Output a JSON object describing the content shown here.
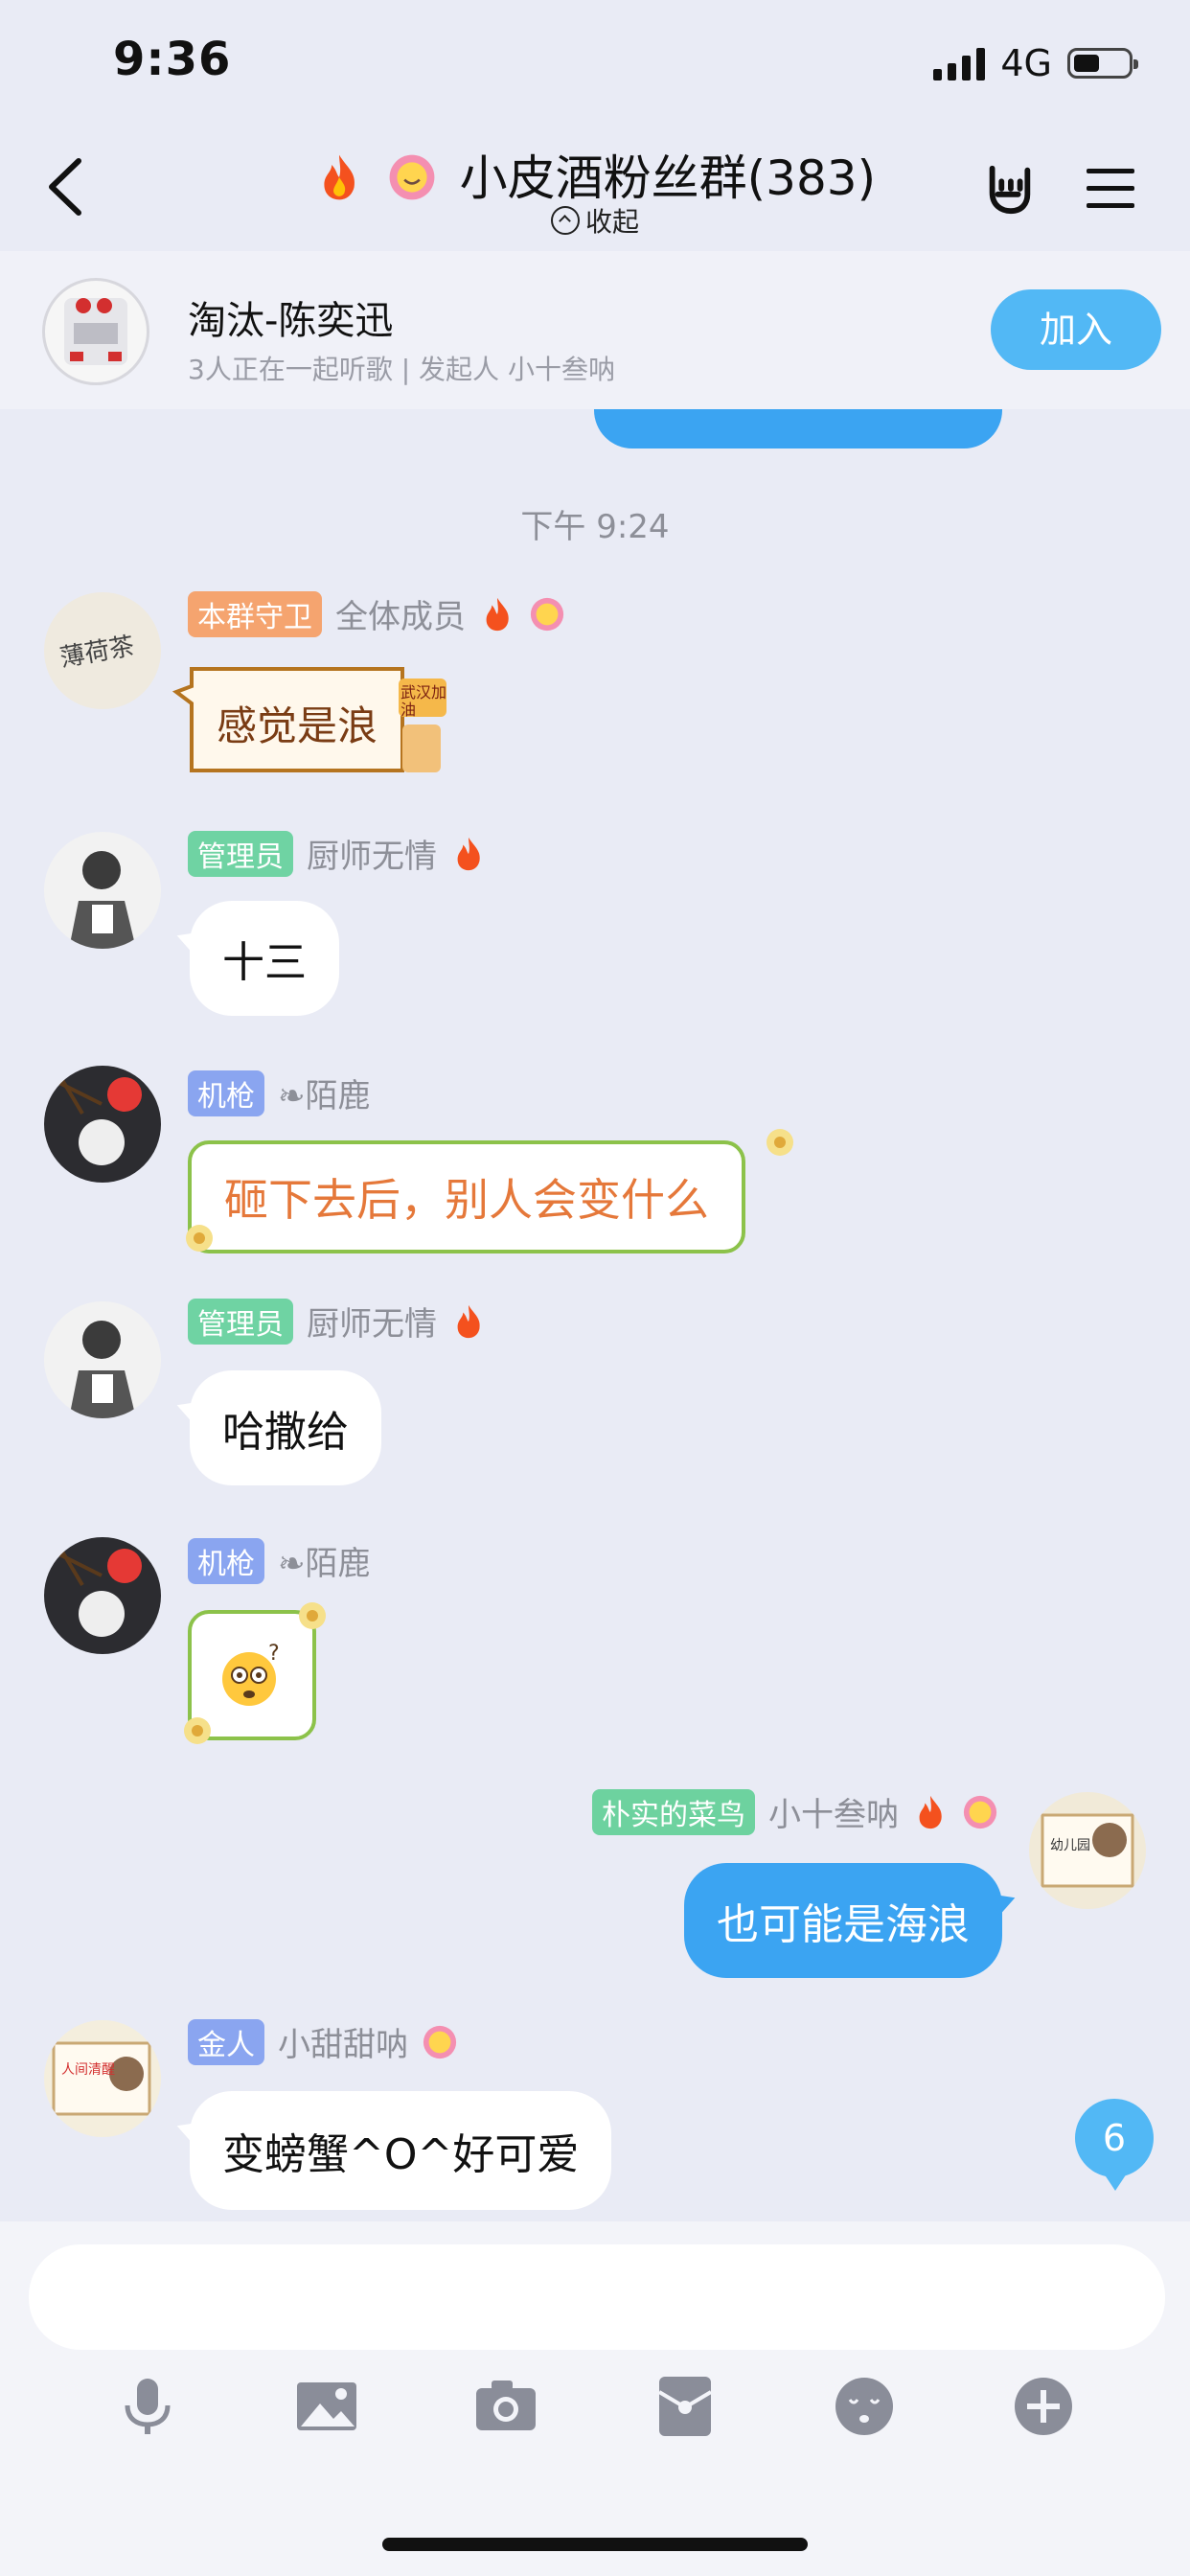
{
  "status_bar": {
    "time": "9:36",
    "network": "4G"
  },
  "header": {
    "title": "小皮酒粉丝群(383)",
    "collapse_label": "收起"
  },
  "listen_bar": {
    "song": "淘汰-陈奕迅",
    "subtitle": "3人正在一起听歌 | 发起人 小十叁呐",
    "join_label": "加入"
  },
  "time_divider": "下午 9:24",
  "messages": [
    {
      "tag": "本群守卫",
      "name": "全体成员",
      "sticker_text": "感觉是浪",
      "sticker_badge": "武汉加油"
    },
    {
      "tag": "管理员",
      "name": "厨师无情",
      "text": "十三"
    },
    {
      "tag": "机枪",
      "name": "❧陌鹿",
      "text": "砸下去后，别人会变什么"
    },
    {
      "tag": "管理员",
      "name": "厨师无情",
      "text": "哈撒给"
    },
    {
      "tag": "机枪",
      "name": "❧陌鹿",
      "emoji": "confused-face"
    },
    {
      "tag": "朴实的菜鸟",
      "name": "小十叁呐",
      "text": "也可能是海浪"
    },
    {
      "tag": "金人",
      "name": "小甜甜呐",
      "text": "变螃蟹^O^好可爱"
    }
  ],
  "unread_count": "6",
  "input": {
    "placeholder": ""
  },
  "toolbar": [
    "microphone-icon",
    "image-icon",
    "camera-icon",
    "red-packet-icon",
    "emoji-icon",
    "plus-icon"
  ],
  "colors": {
    "accent": "#3ba4f2",
    "join": "#52b8f5",
    "background": "#e9ebf5"
  }
}
